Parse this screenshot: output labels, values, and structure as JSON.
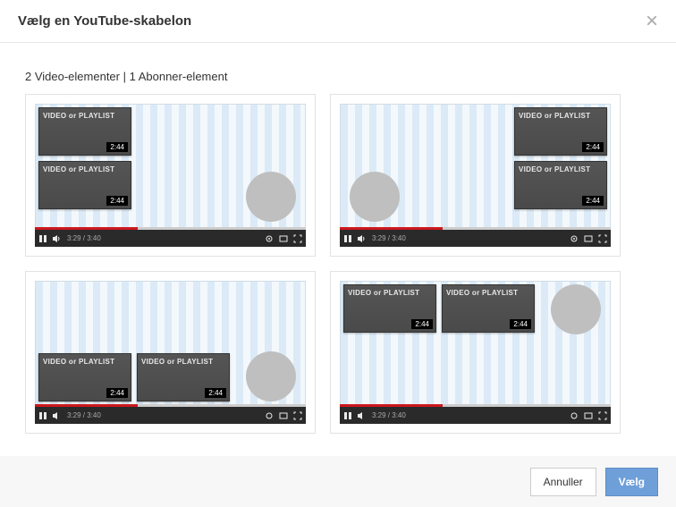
{
  "header": {
    "title": "Vælg en YouTube-skabelon"
  },
  "section": {
    "title": "2 Video-elementer | 1 Abonner-element"
  },
  "thumb": {
    "label": "VIDEO or PLAYLIST",
    "duration": "2:44"
  },
  "player": {
    "time": "3:29 / 3:40"
  },
  "footer": {
    "cancel": "Annuller",
    "select": "Vælg"
  }
}
